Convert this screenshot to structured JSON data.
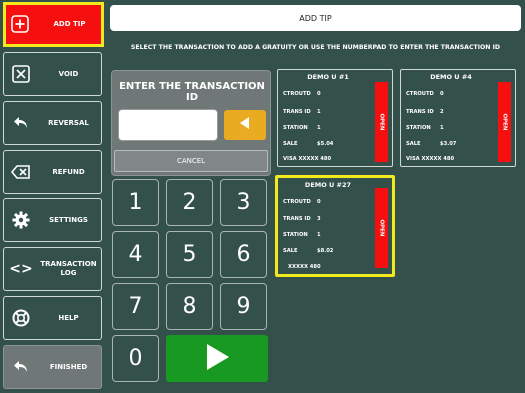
{
  "sidebar": {
    "items": [
      {
        "label": "ADD TIP",
        "icon": "add-tip-icon"
      },
      {
        "label": "VOID",
        "icon": "void-icon"
      },
      {
        "label": "REVERSAL",
        "icon": "reversal-icon"
      },
      {
        "label": "REFUND",
        "icon": "refund-icon"
      },
      {
        "label": "SETTINGS",
        "icon": "gear-icon"
      },
      {
        "label": "TRANSACTION LOG",
        "icon": "code-icon"
      },
      {
        "label": "HELP",
        "icon": "lifebuoy-icon"
      },
      {
        "label": "FINISHED",
        "icon": "finished-icon"
      }
    ]
  },
  "header": {
    "title": "ADD TIP"
  },
  "instruction": "SELECT THE TRANSACTION TO ADD A GRATUITY OR USE THE NUMBERPAD TO ENTER THE TRANSACTION ID",
  "entry": {
    "title": "ENTER THE TRANSACTION ID",
    "value": "",
    "cancel_label": "CANCEL"
  },
  "keypad": {
    "keys": [
      "1",
      "2",
      "3",
      "4",
      "5",
      "6",
      "7",
      "8",
      "9",
      "0"
    ]
  },
  "transactions": [
    {
      "title": "DEMO U  #1",
      "ctroutd_label": "CTROUTD",
      "ctroutd": "0",
      "trans_label": "TRANS ID",
      "trans_id": "1",
      "station_label": "STATION",
      "station": "1",
      "sale_label": "SALE",
      "sale": "$5.04",
      "card": "VISA XXXXX 480",
      "status": "OPEN"
    },
    {
      "title": "DEMO U  #4",
      "ctroutd_label": "CTROUTD",
      "ctroutd": "0",
      "trans_label": "TRANS ID",
      "trans_id": "2",
      "station_label": "STATION",
      "station": "1",
      "sale_label": "SALE",
      "sale": "$3.07",
      "card": "VISA XXXXX 480",
      "status": "OPEN"
    },
    {
      "title": "DEMO U  #27",
      "ctroutd_label": "CTROUTD",
      "ctroutd": "0",
      "trans_label": "TRANS ID",
      "trans_id": "3",
      "station_label": "STATION",
      "station": "1",
      "sale_label": "SALE",
      "sale": "$8.02",
      "card": "XXXXX 480",
      "status": "OPEN"
    }
  ],
  "colors": {
    "background": "#34504a",
    "active": "#f50f0f",
    "highlight": "#f2ea1d",
    "go": "#189a22",
    "backspace": "#e8ab22"
  }
}
